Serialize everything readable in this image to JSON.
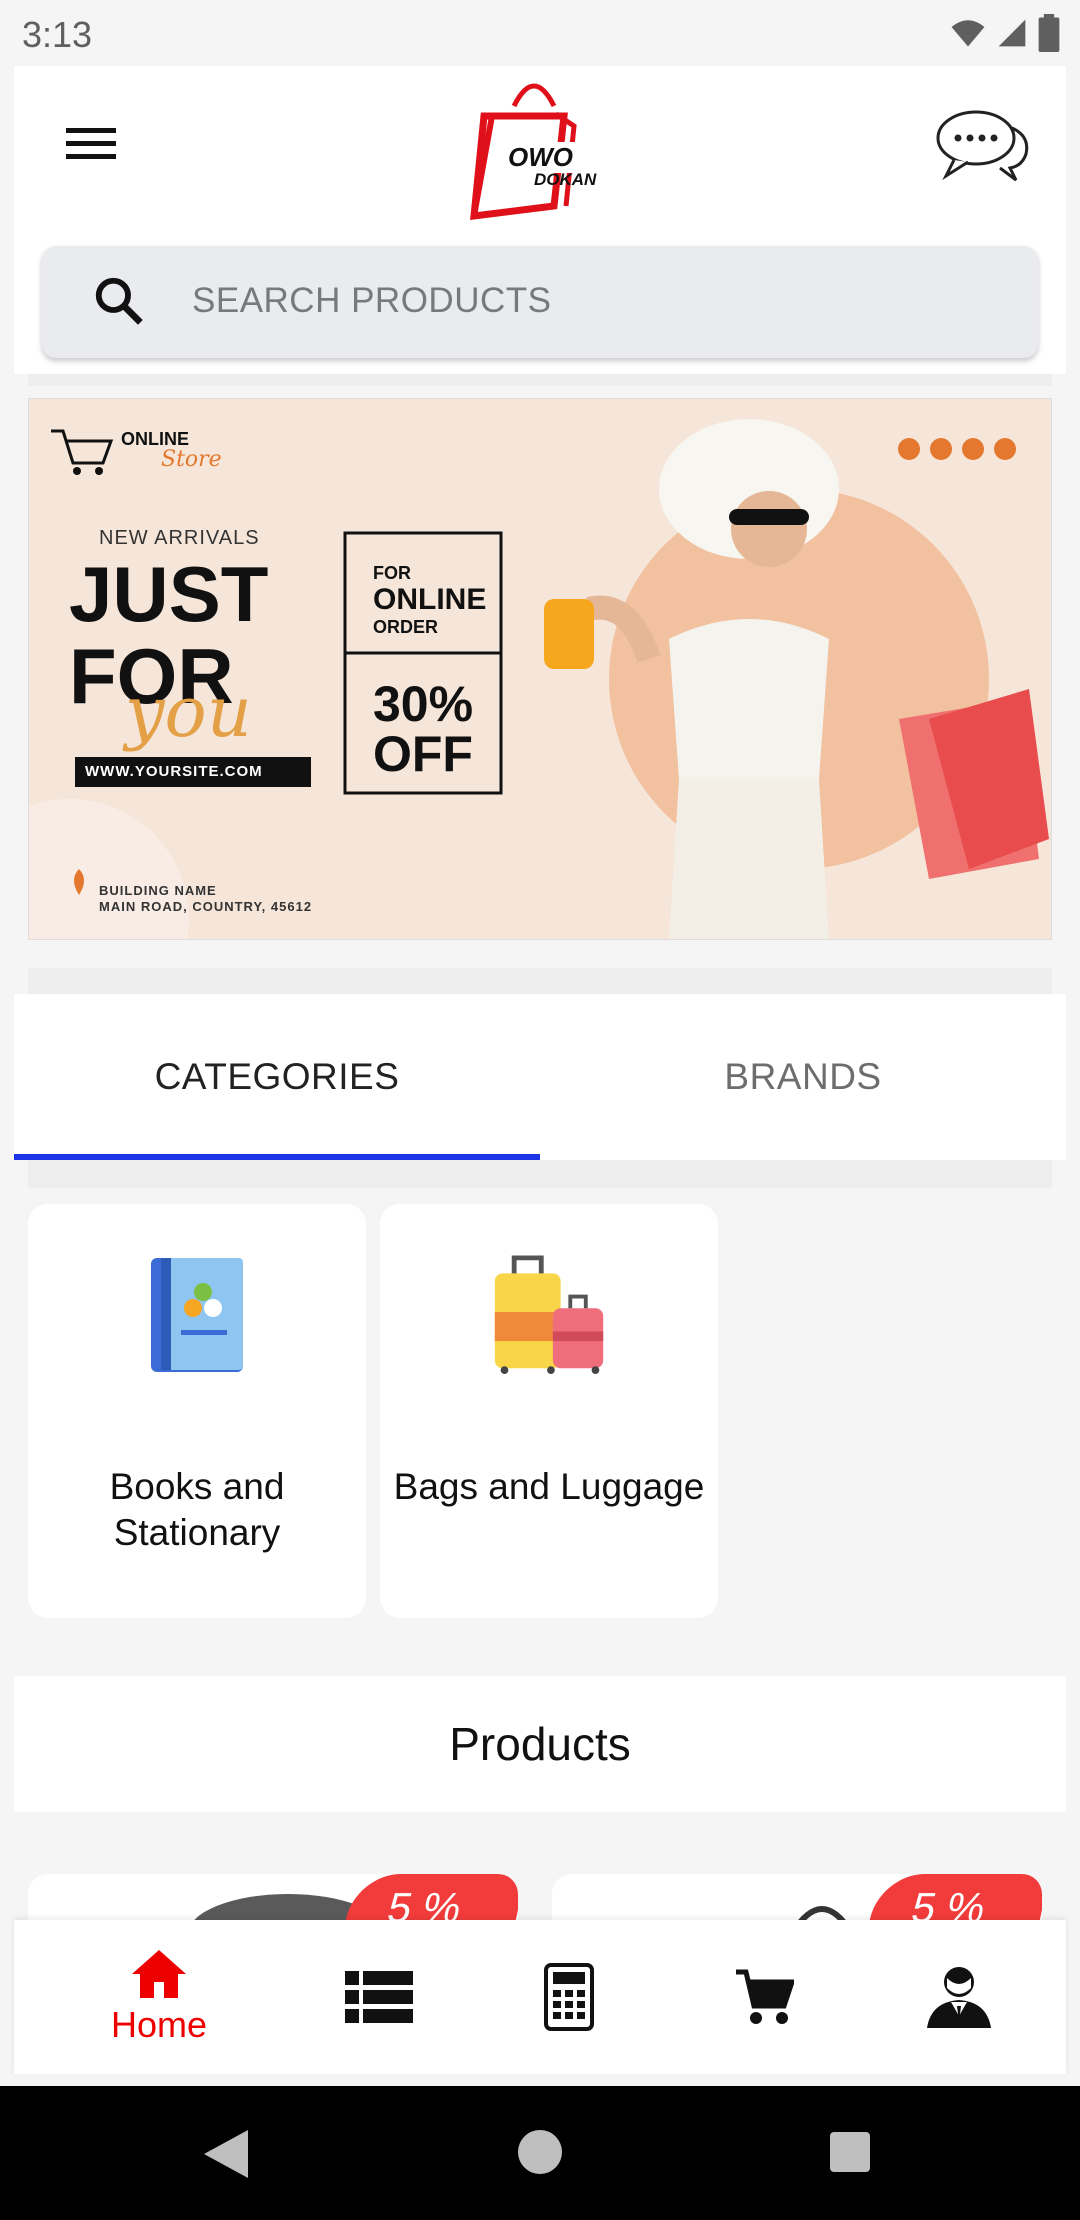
{
  "status_bar": {
    "time": "3:13"
  },
  "header": {
    "logo_text_top": "OWO",
    "logo_text_bottom": "DOKAN"
  },
  "search": {
    "placeholder": "SEARCH PRODUCTS"
  },
  "banner": {
    "store_line1": "ONLINE",
    "store_line2": "Store",
    "new_arrivals": "NEW ARRIVALS",
    "headline_1": "JUST",
    "headline_2": "FOR",
    "headline_script": "you",
    "url": "WWW.YOURSITE.COM",
    "promo_line1": "FOR",
    "promo_line2": "ONLINE",
    "promo_line3": "ORDER",
    "promo_discount_1": "30%",
    "promo_discount_2": "OFF",
    "address_1": "BUILDING NAME",
    "address_2": "MAIN ROAD, COUNTRY, 45612"
  },
  "tabs": [
    {
      "label": "CATEGORIES",
      "active": true
    },
    {
      "label": "BRANDS",
      "active": false
    }
  ],
  "categories": [
    {
      "label": "Books and Stationary",
      "icon": "book-icon"
    },
    {
      "label": "Bags and Luggage",
      "icon": "luggage-icon"
    }
  ],
  "products": {
    "title": "Products",
    "items": [
      {
        "discount": "5 %"
      },
      {
        "discount": "5 %"
      }
    ]
  },
  "bottom_nav": {
    "home_label": "Home",
    "active_color": "#ee0000"
  },
  "colors": {
    "accent_blue": "#1a34e6",
    "brand_red": "#e0101b",
    "badge_red": "#f23b3b"
  }
}
